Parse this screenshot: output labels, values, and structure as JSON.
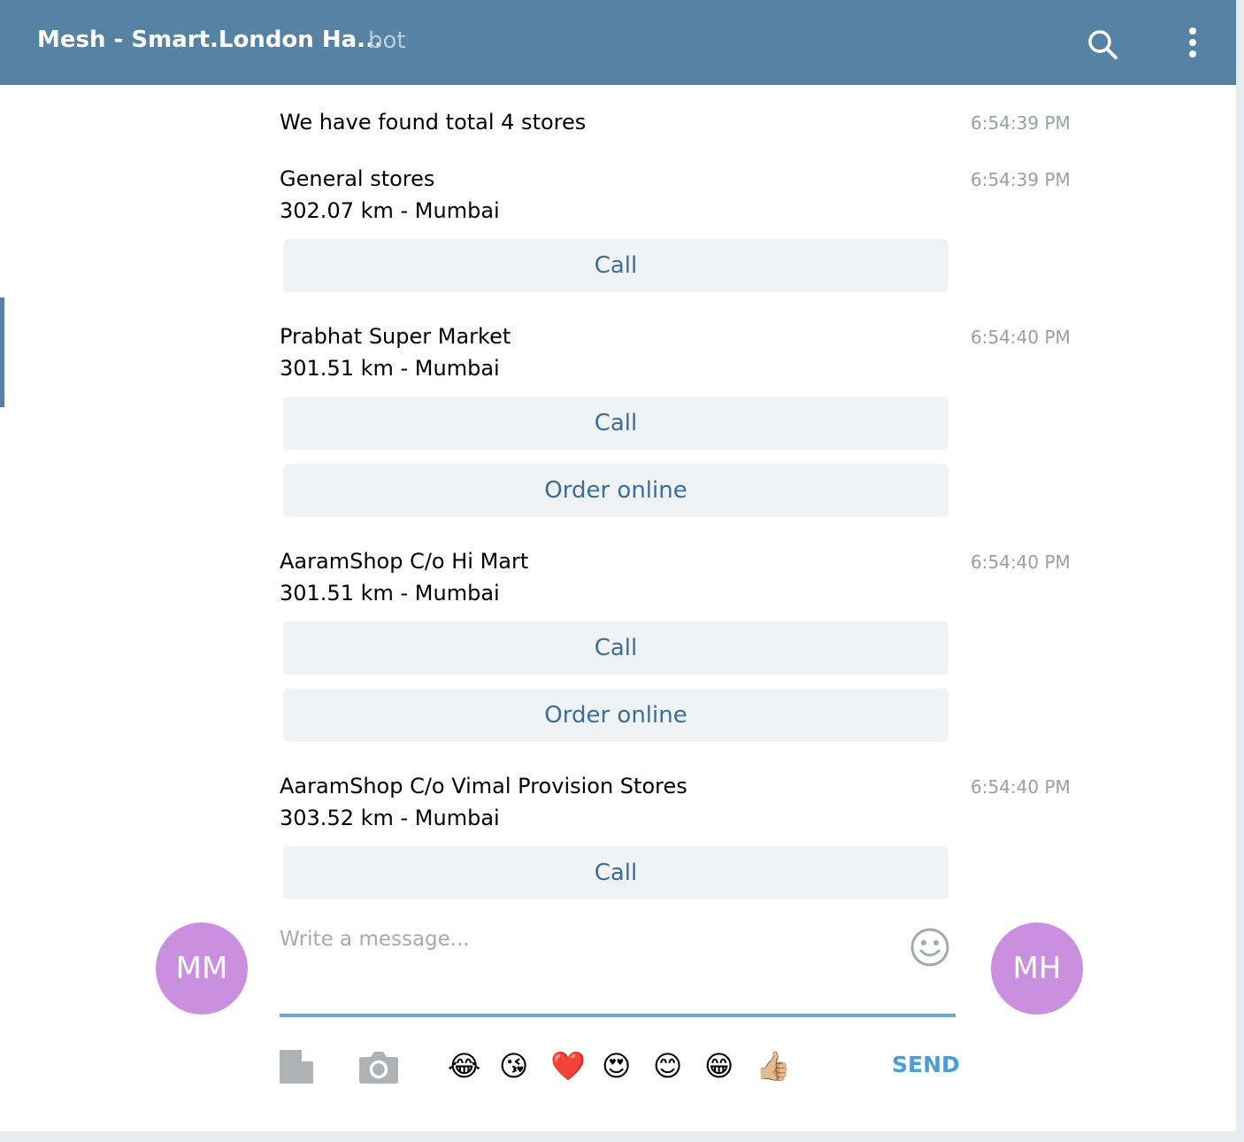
{
  "header": {
    "title": "Mesh - Smart.London Ha...",
    "subtitle": "bot"
  },
  "messages": [
    {
      "line1": "We have found total 4 stores",
      "line2": "",
      "time": "6:54:39 PM"
    },
    {
      "line1": "General stores",
      "line2": "302.07 km - Mumbai",
      "time": "6:54:39 PM"
    },
    {
      "line1": "Prabhat Super Market",
      "line2": "301.51 km - Mumbai",
      "time": "6:54:40 PM"
    },
    {
      "line1": "AaramShop C/o Hi Mart",
      "line2": "301.51 km - Mumbai",
      "time": "6:54:40 PM"
    },
    {
      "line1": "AaramShop C/o Vimal Provision Stores",
      "line2": "303.52 km - Mumbai",
      "time": "6:54:40 PM"
    }
  ],
  "buttons": {
    "call": "Call",
    "order_online": "Order online"
  },
  "avatars": {
    "left": "MM",
    "right": "MH"
  },
  "composer": {
    "placeholder": "Write a message...",
    "send_label": "SEND",
    "quick_emojis": [
      "😂",
      "😘",
      "❤️",
      "😍",
      "😊",
      "😁",
      "👍🏼"
    ]
  },
  "colors": {
    "header_bg": "#5682a3",
    "button_text": "#3a6d99",
    "avatar_bg": "#cb8fe0",
    "send": "#4a9dd8"
  }
}
